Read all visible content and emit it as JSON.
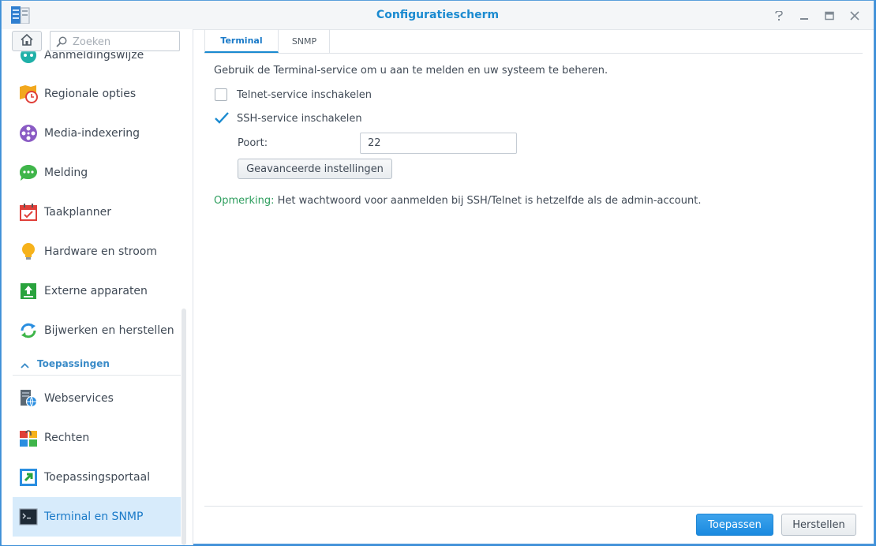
{
  "window": {
    "title": "Configuratiescherm",
    "controls": [
      "help-icon",
      "minimize-icon",
      "maximize-icon",
      "close-icon"
    ]
  },
  "sidebar": {
    "home_icon": "home-icon",
    "search": {
      "placeholder": "Zoeken",
      "value": ""
    },
    "items": [
      {
        "label": "Aanmeldingswijze",
        "icon": "login-method-icon"
      },
      {
        "label": "Regionale opties",
        "icon": "regional-options-icon"
      },
      {
        "label": "Media-indexering",
        "icon": "media-indexing-icon"
      },
      {
        "label": "Melding",
        "icon": "notification-icon"
      },
      {
        "label": "Taakplanner",
        "icon": "task-scheduler-icon"
      },
      {
        "label": "Hardware en stroom",
        "icon": "hardware-power-icon"
      },
      {
        "label": "Externe apparaten",
        "icon": "external-devices-icon"
      },
      {
        "label": "Bijwerken en herstellen",
        "icon": "update-restore-icon"
      }
    ],
    "section": {
      "label": "Toepassingen",
      "icon": "chevron-up-icon"
    },
    "app_items": [
      {
        "label": "Webservices",
        "icon": "web-services-icon"
      },
      {
        "label": "Rechten",
        "icon": "privileges-icon"
      },
      {
        "label": "Toepassingsportaal",
        "icon": "application-portal-icon"
      },
      {
        "label": "Terminal en SNMP",
        "icon": "terminal-snmp-icon",
        "active": true
      }
    ]
  },
  "tabs": [
    {
      "label": "Terminal",
      "active": true
    },
    {
      "label": "SNMP",
      "active": false
    }
  ],
  "terminal": {
    "description": "Gebruik de Terminal-service om u aan te melden en uw systeem te beheren.",
    "telnet": {
      "label": "Telnet-service inschakelen",
      "checked": false
    },
    "ssh": {
      "label": "SSH-service inschakelen",
      "checked": true
    },
    "port": {
      "label": "Poort:",
      "value": "22"
    },
    "advanced_button": "Geavanceerde instellingen",
    "note": {
      "prefix": "Opmerking:",
      "text": " Het wachtwoord voor aanmelden bij SSH/Telnet is hetzelfde als de admin-account."
    }
  },
  "footer": {
    "apply": "Toepassen",
    "reset": "Herstellen"
  },
  "colors": {
    "accent": "#1a8ad0",
    "active_item_bg": "#d7ebfb",
    "note_prefix": "#2e9e5e",
    "apply_button": "#1a8ae0"
  }
}
